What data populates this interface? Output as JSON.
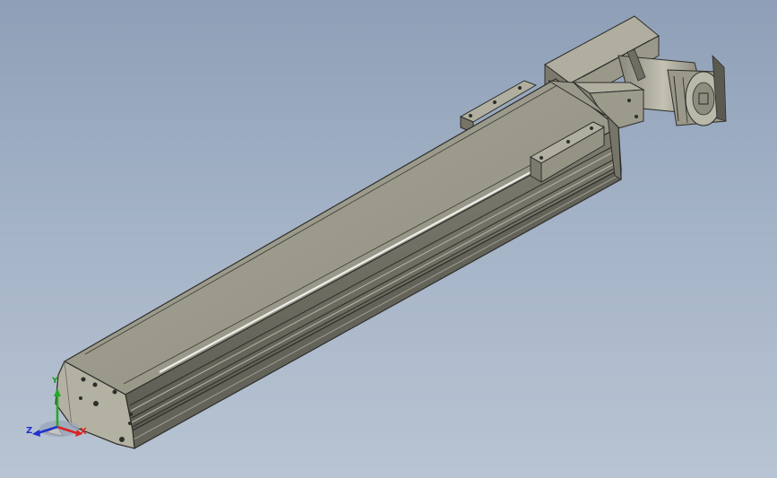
{
  "viewport": {
    "background_top": "#8e9fb7",
    "background_bottom": "#b8c4d3"
  },
  "model": {
    "body_color": "#8f8e80",
    "top_color": "#a19f90",
    "edge_color": "#2e2e2a",
    "motor_color": "#a6a595"
  },
  "triad": {
    "x_label": "X",
    "y_label": "Y",
    "z_label": "Z",
    "x_color": "#dd2222",
    "y_color": "#22aa22",
    "z_color": "#2233cc"
  }
}
